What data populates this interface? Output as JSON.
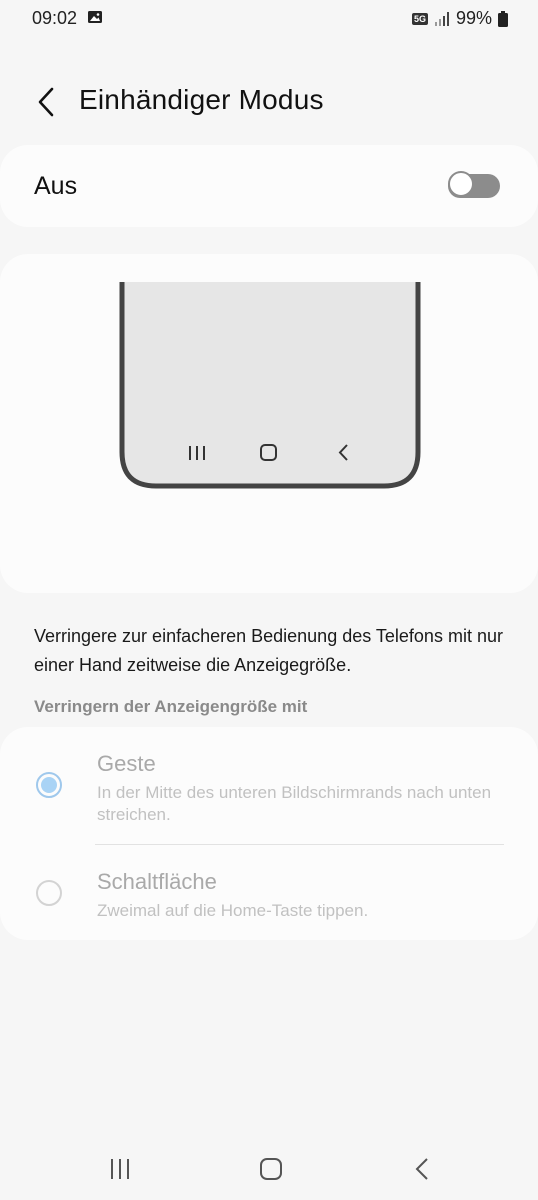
{
  "status_bar": {
    "time": "09:02",
    "network": "5G",
    "battery": "99%",
    "icons": [
      "gallery-icon",
      "signal-icon",
      "battery-icon"
    ]
  },
  "header": {
    "title": "Einhändiger Modus",
    "back_icon": "back-arrow-icon"
  },
  "toggle": {
    "label": "Aus",
    "state": "off"
  },
  "preview": {
    "nav_icons": [
      "recents-icon",
      "home-icon",
      "back-icon"
    ]
  },
  "description": "Verringere zur einfacheren Bedienung des Telefons mit nur einer Hand zeitweise die Anzeigegröße.",
  "section_header": "Verringern der Anzeigengröße mit",
  "options": [
    {
      "title": "Geste",
      "subtitle": "In der Mitte des unteren Bildschirmrands nach unten streichen.",
      "selected": true
    },
    {
      "title": "Schaltfläche",
      "subtitle": "Zweimal auf die Home-Taste tippen.",
      "selected": false
    }
  ],
  "colors": {
    "background": "#f6f6f6",
    "card": "#fcfcfc",
    "radio_selected": "#a9d3f5",
    "disabled_text": "#a9a9a9"
  },
  "nav_bar": {
    "icons": [
      "recents-icon",
      "home-icon",
      "back-icon"
    ]
  }
}
